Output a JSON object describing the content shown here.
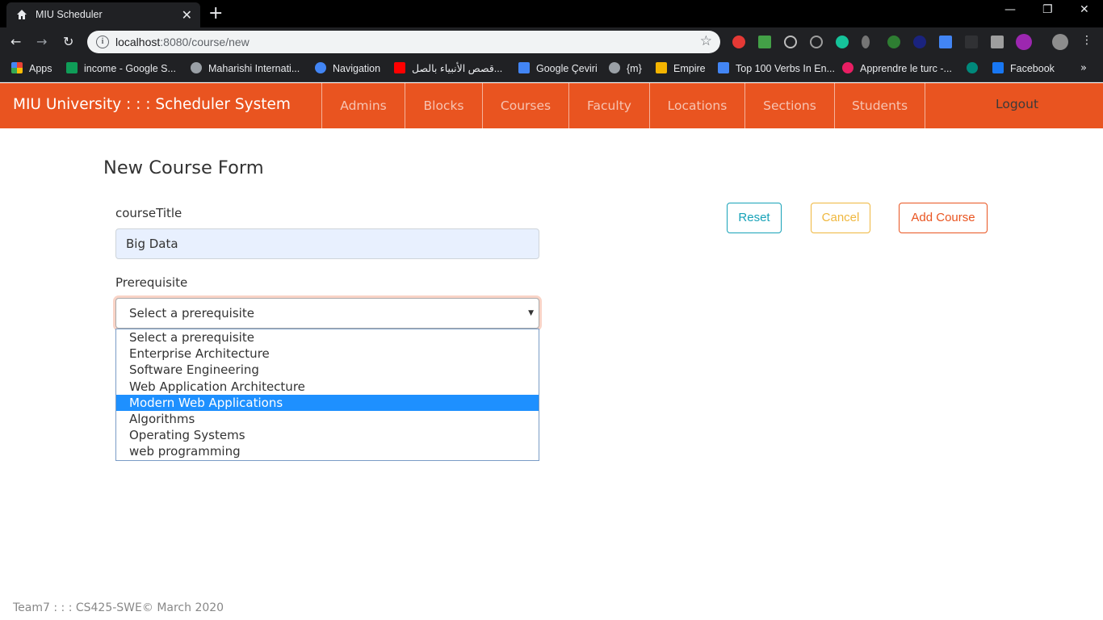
{
  "browser": {
    "tab_title": "MIU Scheduler",
    "url_host": "localhost",
    "url_rest": ":8080/course/new",
    "bookmarks": [
      {
        "label": "Apps",
        "color": "#ea4335"
      },
      {
        "label": "income - Google S...",
        "color": "#0f9d58"
      },
      {
        "label": "Maharishi Internati...",
        "color": "#9aa0a6"
      },
      {
        "label": "Navigation",
        "color": "#4285f4"
      },
      {
        "label": "قصص الأنبياء بالصل...",
        "color": "#ff0000"
      },
      {
        "label": "Google Çeviri",
        "color": "#4285f4"
      },
      {
        "label": "{m}",
        "color": "#9aa0a6"
      },
      {
        "label": "Empire",
        "color": "#f4b400"
      },
      {
        "label": "Top 100 Verbs In En...",
        "color": "#4285f4"
      },
      {
        "label": "Apprendre le turc -...",
        "color": "#e91e63"
      },
      {
        "label": "",
        "color": "#00897b"
      },
      {
        "label": "Facebook",
        "color": "#1877f2"
      }
    ]
  },
  "navbar": {
    "brand": "MIU University : : : Scheduler System",
    "links": [
      "Admins",
      "Blocks",
      "Courses",
      "Faculty",
      "Locations",
      "Sections",
      "Students"
    ],
    "logout": "Logout",
    "color": "#e95420"
  },
  "form": {
    "title": "New Course Form",
    "course_title_label": "courseTitle",
    "course_title_value": "Big Data",
    "prerequisite_label": "Prerequisite",
    "prerequisite_selected": "Select a prerequisite",
    "options": [
      "Select a prerequisite",
      "Enterprise Architecture",
      "Software Engineering",
      "Web Application Architecture",
      "Modern Web Applications",
      "Algorithms",
      "Operating Systems",
      "web programming"
    ],
    "highlighted_option": "Modern Web Applications",
    "buttons": {
      "reset": "Reset",
      "cancel": "Cancel",
      "add": "Add Course"
    }
  },
  "footer": "Team7 : : : CS425-SWE© March 2020"
}
